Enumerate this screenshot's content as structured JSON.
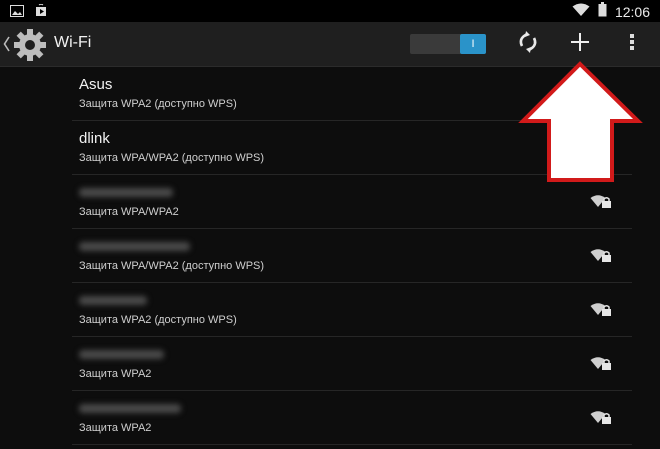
{
  "status_bar": {
    "time": "12:06",
    "left_icons": [
      "gallery-icon",
      "play-store-icon"
    ],
    "right_icons": [
      "wifi-status-icon",
      "battery-icon"
    ]
  },
  "action_bar": {
    "title": "Wi-Fi",
    "toggle_state_label": "I",
    "toggle_on": true,
    "accent_color": "#2a93c9",
    "actions": [
      "scan-icon",
      "add-network-icon",
      "overflow-menu-icon"
    ]
  },
  "networks": [
    {
      "ssid": "Asus",
      "security": "Защита WPA2 (доступно WPS)",
      "ssid_obscured": false,
      "signal_shown": false
    },
    {
      "ssid": "dlink",
      "security": "Защита WPA/WPA2 (доступно WPS)",
      "ssid_obscured": false,
      "signal_shown": false
    },
    {
      "ssid": "",
      "security": "Защита WPA/WPA2",
      "ssid_obscured": true,
      "signal_shown": true
    },
    {
      "ssid": "",
      "security": "Защита WPA/WPA2 (доступно WPS)",
      "ssid_obscured": true,
      "signal_shown": true
    },
    {
      "ssid": "",
      "security": "Защита WPA2 (доступно WPS)",
      "ssid_obscured": true,
      "signal_shown": true
    },
    {
      "ssid": "",
      "security": "Защита WPA2",
      "ssid_obscured": true,
      "signal_shown": true
    },
    {
      "ssid": "",
      "security": "Защита WPA2",
      "ssid_obscured": true,
      "signal_shown": true
    }
  ],
  "annotation": {
    "shape": "arrow-up",
    "points_to": "add-network-button",
    "color": "#d11a1a"
  }
}
